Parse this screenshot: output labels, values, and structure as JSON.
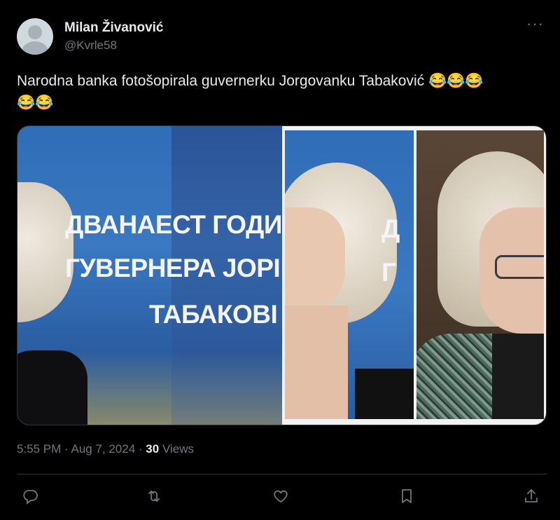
{
  "author": {
    "name": "Milan Živanović",
    "handle": "@Kvrle58"
  },
  "tweet": {
    "text": "Narodna banka fotošopirala guvernerku Jorgovanku Tabaković ",
    "emojis_line1": "😂😂😂",
    "emojis_line2": "😂😂"
  },
  "media": {
    "banner_line1": "ДВАНАЕСТ ГОДИ",
    "banner_line2": "ГУВЕРНЕРА ЈОРІ",
    "banner_line3": "ТАБАКОВІ",
    "right_banner_line1": "Д",
    "right_banner_line2": "Г"
  },
  "meta": {
    "time": "5:55 PM",
    "sep1": " · ",
    "date": "Aug 7, 2024",
    "sep2": " · ",
    "views_count": "30",
    "views_label": " Views"
  },
  "icons": {
    "reply": "reply-icon",
    "retweet": "retweet-icon",
    "like": "heart-icon",
    "bookmark": "bookmark-icon",
    "share": "share-icon",
    "more": "more-icon"
  },
  "colors": {
    "background": "#000000",
    "text_primary": "#e7e9ea",
    "text_secondary": "#71767b",
    "border": "#2f3336"
  }
}
